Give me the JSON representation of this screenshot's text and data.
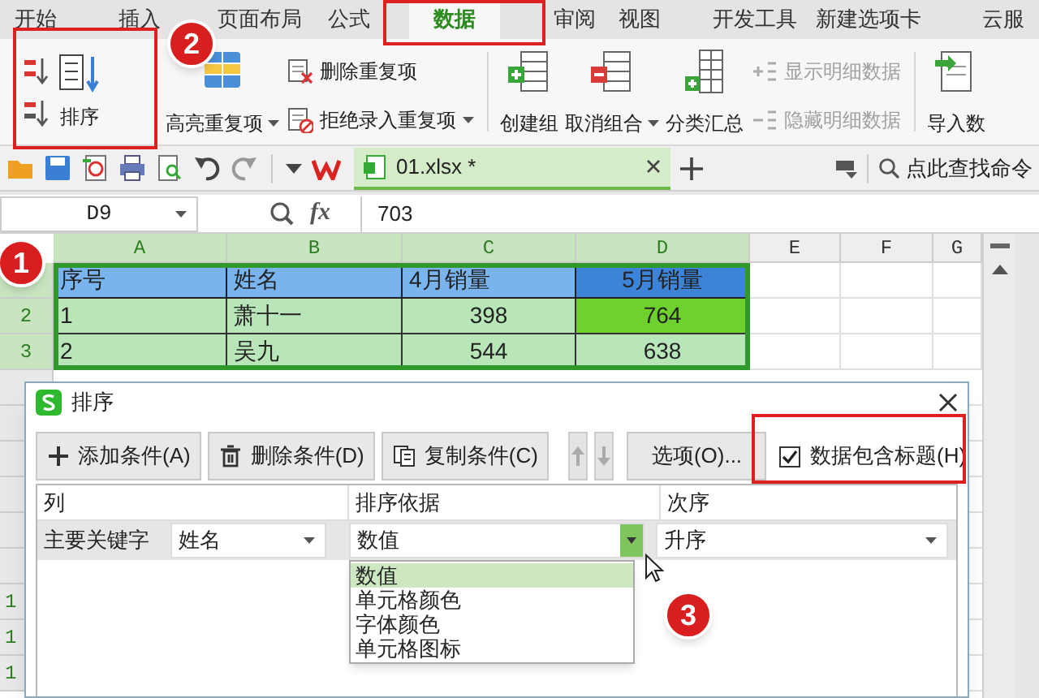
{
  "ribbon_tabs": [
    {
      "label": "开始",
      "selected": false
    },
    {
      "label": "插入",
      "selected": false
    },
    {
      "label": "页面布局",
      "selected": false
    },
    {
      "label": "公式",
      "selected": false
    },
    {
      "label": "数据",
      "selected": true
    },
    {
      "label": "审阅",
      "selected": false
    },
    {
      "label": "视图",
      "selected": false
    },
    {
      "label": "开发工具",
      "selected": false
    },
    {
      "label": "新建选项卡",
      "selected": false
    },
    {
      "label": "云服",
      "selected": false
    }
  ],
  "ribbon": [
    {
      "kind": "sort",
      "label": "排序"
    },
    {
      "kind": "large",
      "label": "高亮重复项",
      "caret": true
    },
    {
      "kind": "stack",
      "items": [
        {
          "label": "删除重复项",
          "caret": false,
          "disabled": false
        },
        {
          "label": "拒绝录入重复项",
          "caret": true,
          "disabled": false
        }
      ]
    },
    {
      "kind": "separator"
    },
    {
      "kind": "large",
      "label": "创建组",
      "caret": false
    },
    {
      "kind": "large",
      "label": "取消组合",
      "caret": true
    },
    {
      "kind": "large",
      "label": "分类汇总",
      "caret": false
    },
    {
      "kind": "stack",
      "items": [
        {
          "label": "显示明细数据",
          "caret": false,
          "disabled": true
        },
        {
          "label": "隐藏明细数据",
          "caret": false,
          "disabled": true
        }
      ]
    },
    {
      "kind": "separator"
    },
    {
      "kind": "large",
      "label": "导入数",
      "caret": false
    }
  ],
  "file_tab": {
    "label": "01.xlsx *"
  },
  "search_command": {
    "label": "点此查找命令"
  },
  "formula_bar": {
    "name_box": "D9",
    "fx": "fx",
    "value": "703"
  },
  "columns": [
    "A",
    "B",
    "C",
    "D",
    "E",
    "F",
    "G"
  ],
  "rows": [
    {
      "number": "",
      "cells": [
        "序号",
        "姓名",
        "4月销量",
        "5月销量"
      ]
    },
    {
      "number": "2",
      "cells": [
        "1",
        "萧十一",
        "398",
        "764"
      ]
    },
    {
      "number": "3",
      "cells": [
        "2",
        "吴九",
        "544",
        "638"
      ]
    }
  ],
  "hidden_row_numbers": [
    "1",
    "1",
    "1"
  ],
  "dialog": {
    "title": "排序",
    "buttons": [
      {
        "label": "添加条件(A)",
        "kind": "add"
      },
      {
        "label": "删除条件(D)",
        "kind": "delete"
      },
      {
        "label": "复制条件(C)",
        "kind": "copy"
      },
      {
        "kind": "up"
      },
      {
        "kind": "down"
      },
      {
        "label": "选项(O)...",
        "kind": "text"
      }
    ],
    "has_header": {
      "label": "数据包含标题(H)",
      "checked": true
    },
    "columns": [
      "列",
      "排序依据",
      "次序"
    ],
    "row": {
      "label": "主要关键字",
      "column": "姓名",
      "sort_on": "数值",
      "order": "升序"
    },
    "sort_on_options": [
      {
        "label": "数值",
        "selected": true
      },
      {
        "label": "单元格颜色",
        "selected": false
      },
      {
        "label": "字体颜色",
        "selected": false
      },
      {
        "label": "单元格图标",
        "selected": false
      }
    ]
  },
  "annotations": [
    "1",
    "2",
    "3"
  ]
}
